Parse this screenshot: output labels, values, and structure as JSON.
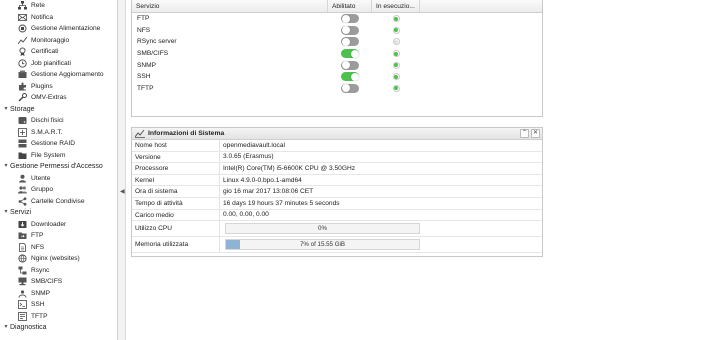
{
  "sidebar": {
    "items": [
      {
        "kind": "item",
        "label": "Rete",
        "icon": "network-icon"
      },
      {
        "kind": "item",
        "label": "Notifica",
        "icon": "mail-icon"
      },
      {
        "kind": "item",
        "label": "Gestione Alimentazione",
        "icon": "power-icon"
      },
      {
        "kind": "item",
        "label": "Monitoraggio",
        "icon": "chart-icon"
      },
      {
        "kind": "item",
        "label": "Certificati",
        "icon": "certificate-icon"
      },
      {
        "kind": "item",
        "label": "Job pianificati",
        "icon": "clock-icon"
      },
      {
        "kind": "item",
        "label": "Gestione Aggiornamento",
        "icon": "update-icon"
      },
      {
        "kind": "item",
        "label": "Plugins",
        "icon": "puzzle-icon"
      },
      {
        "kind": "item",
        "label": "OMV-Extras",
        "icon": "wrench-icon"
      },
      {
        "kind": "section",
        "label": "Storage"
      },
      {
        "kind": "item",
        "label": "Dischi fisici",
        "icon": "disk-icon"
      },
      {
        "kind": "item",
        "label": "S.M.A.R.T.",
        "icon": "smart-icon"
      },
      {
        "kind": "item",
        "label": "Gestione RAID",
        "icon": "raid-icon"
      },
      {
        "kind": "item",
        "label": "File System",
        "icon": "filesystem-icon"
      },
      {
        "kind": "section",
        "label": "Gestione Permessi d'Accesso"
      },
      {
        "kind": "item",
        "label": "Utente",
        "icon": "user-icon"
      },
      {
        "kind": "item",
        "label": "Gruppo",
        "icon": "group-icon"
      },
      {
        "kind": "item",
        "label": "Cartelle Condivise",
        "icon": "share-icon"
      },
      {
        "kind": "section",
        "label": "Servizi"
      },
      {
        "kind": "item",
        "label": "Downloader",
        "icon": "download-icon"
      },
      {
        "kind": "item",
        "label": "FTP",
        "icon": "ftp-icon"
      },
      {
        "kind": "item",
        "label": "NFS",
        "icon": "nfs-icon"
      },
      {
        "kind": "item",
        "label": "Nginx (websites)",
        "icon": "nginx-icon"
      },
      {
        "kind": "item",
        "label": "Rsync",
        "icon": "rsync-icon"
      },
      {
        "kind": "item",
        "label": "SMB/CIFS",
        "icon": "smb-icon"
      },
      {
        "kind": "item",
        "label": "SNMP",
        "icon": "snmp-icon"
      },
      {
        "kind": "item",
        "label": "SSH",
        "icon": "ssh-icon"
      },
      {
        "kind": "item",
        "label": "TFTP",
        "icon": "tftp-icon"
      },
      {
        "kind": "section",
        "label": "Diagnostica"
      }
    ]
  },
  "services": {
    "headers": {
      "name": "Servizio",
      "enabled": "Abilitato",
      "running": "In esecuzio..."
    },
    "rows": [
      {
        "name": "FTP",
        "enabled": false,
        "running": true
      },
      {
        "name": "NFS",
        "enabled": false,
        "running": true
      },
      {
        "name": "RSync server",
        "enabled": false,
        "running": false
      },
      {
        "name": "SMB/CIFS",
        "enabled": true,
        "running": true
      },
      {
        "name": "SNMP",
        "enabled": false,
        "running": true
      },
      {
        "name": "SSH",
        "enabled": true,
        "running": true
      },
      {
        "name": "TFTP",
        "enabled": false,
        "running": true
      }
    ]
  },
  "sysinfo": {
    "title": "Informazioni di Sistema",
    "rows": [
      {
        "key": "Nome host",
        "value": "openmediavault.local"
      },
      {
        "key": "Versione",
        "value": "3.0.65 (Erasmus)"
      },
      {
        "key": "Processore",
        "value": "Intel(R) Core(TM) i5-6600K CPU @ 3.50GHz"
      },
      {
        "key": "Kernel",
        "value": "Linux 4.9.0-0.bpo.1-amd64"
      },
      {
        "key": "Ora di sistema",
        "value": "gio 16 mar 2017 13:08:06 CET"
      },
      {
        "key": "Tempo di attività",
        "value": "16 days 19 hours 37 minutes 5 seconds"
      },
      {
        "key": "Carico medio",
        "value": "0.00, 0.00, 0.00"
      }
    ],
    "cpu": {
      "key": "Utilizzo CPU",
      "text": "0%",
      "fraction": 0.0
    },
    "memory": {
      "key": "Memoria utilizzata",
      "text": "7% of 15.55 GiB",
      "fraction": 0.07
    }
  },
  "colors": {
    "toggle_on": "#4cc14c",
    "toggle_off": "#9c9c9c",
    "running_dot": "#49c449",
    "bar_fill": "#8fb3d4"
  }
}
